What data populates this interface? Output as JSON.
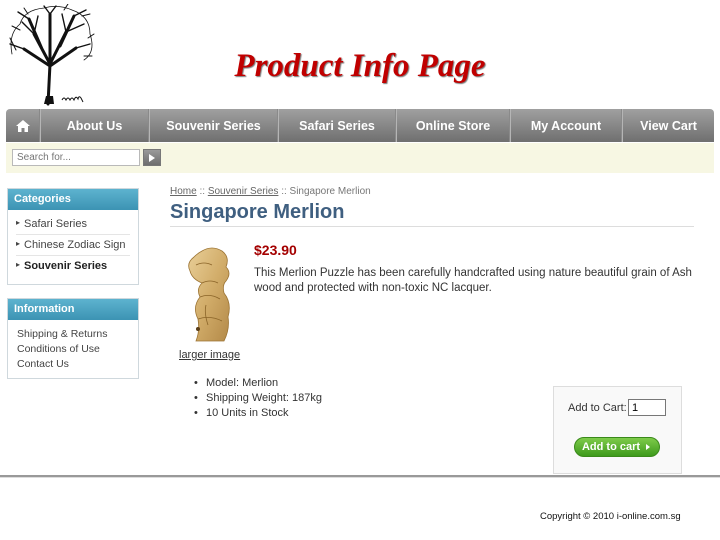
{
  "page_heading": "Product Info Page",
  "logo": {
    "icon": "tree-logo-icon",
    "signature": "Joosoodz"
  },
  "nav": {
    "home_icon": "home-icon",
    "items": [
      {
        "label": "About Us"
      },
      {
        "label": "Souvenir Series"
      },
      {
        "label": "Safari Series"
      },
      {
        "label": "Online Store"
      },
      {
        "label": "My Account"
      },
      {
        "label": "View Cart"
      }
    ]
  },
  "search": {
    "placeholder": "Search for...",
    "button_icon": "play-arrow-icon"
  },
  "categories": {
    "title": "Categories",
    "items": [
      {
        "label": "Safari Series"
      },
      {
        "label": "Chinese Zodiac Sign"
      },
      {
        "label": "Souvenir Series",
        "active": true
      }
    ]
  },
  "information": {
    "title": "Information",
    "items": [
      {
        "label": "Shipping & Returns"
      },
      {
        "label": "Conditions of Use"
      },
      {
        "label": "Contact Us"
      }
    ]
  },
  "breadcrumb": {
    "home": "Home",
    "sep": "::",
    "category": "Souvenir Series",
    "current": "Singapore Merlion"
  },
  "product": {
    "title": "Singapore Merlion",
    "price": "$23.90",
    "description": "This Merlion Puzzle has been carefully handcrafted using nature beautiful grain of Ash wood and protected with non-toxic NC lacquer.",
    "larger_image_label": "larger image",
    "specs": [
      "Model: Merlion",
      "Shipping Weight: 187kg",
      "10 Units in Stock"
    ]
  },
  "cart": {
    "label": "Add to Cart:",
    "quantity": "1",
    "button_label": "Add to cart"
  },
  "footer": {
    "copyright": "Copyright © 2010  i-online.com.sg"
  },
  "colors": {
    "heading": "#c00000",
    "nav": "#7f7f7f",
    "sidebox_head": "#4aa3c3",
    "price": "#a40000",
    "title": "#3f5f80",
    "add_button": "#4fae2a"
  }
}
